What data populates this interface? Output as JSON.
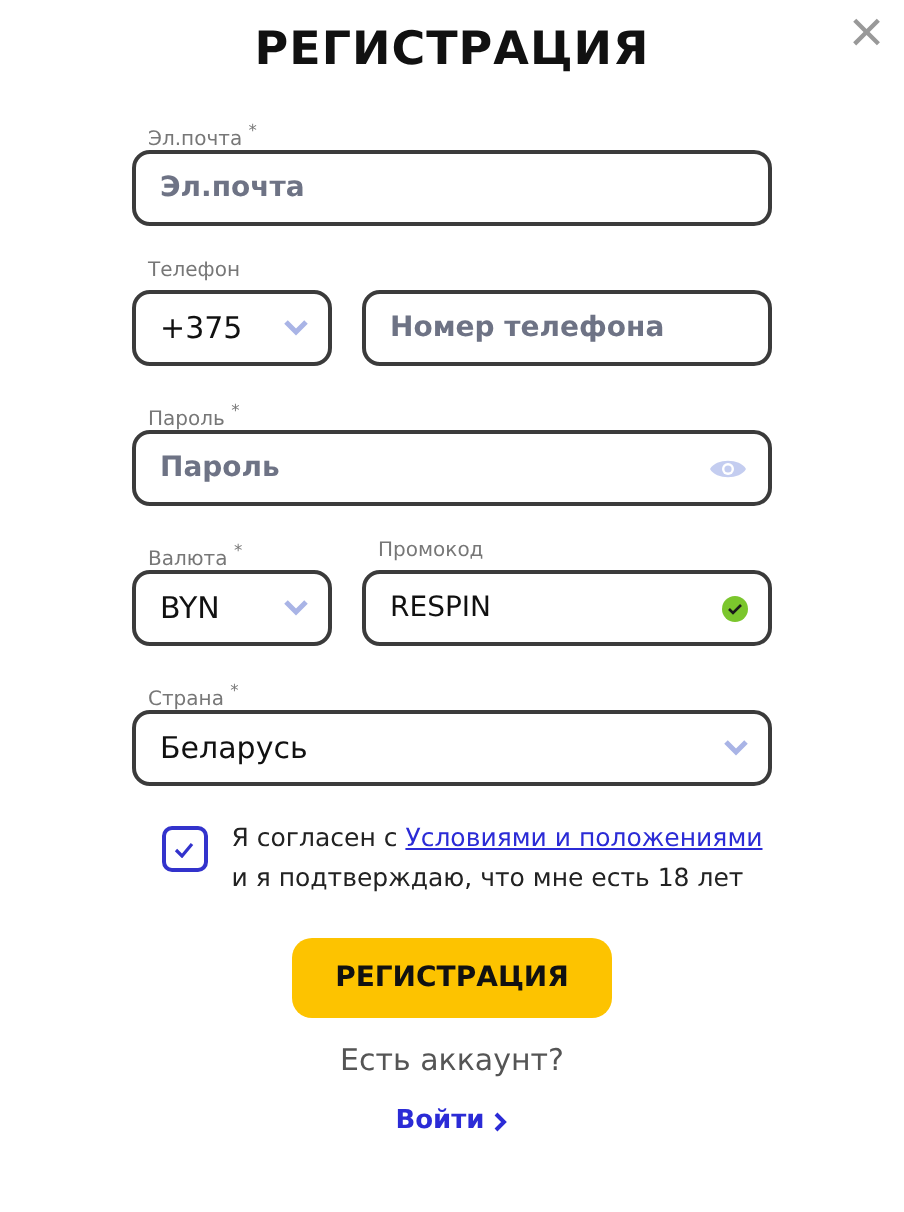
{
  "title": "РЕГИСТРАЦИЯ",
  "close": "×",
  "rows": [
    {
      "fields": [
        {
          "kind": "text",
          "label": "Эл.почта $^{*}$",
          "placeholder": "Эл.почта"
        }
      ]
    },
    {
      "fields": [
        {
          "kind": "select",
          "label": "Телефон",
          "value": "+375"
        },
        {
          "kind": "text",
          "placeholder": "Номер телефона"
        }
      ]
    },
    {
      "fields": [
        {
          "kind": "password",
          "label": "Пароль $^{*}$",
          "placeholder": "Пароль"
        }
      ]
    },
    {
      "fields": [
        {
          "kind": "select",
          "label": "Валюта $^{*}$",
          "value": "BYN"
        },
        {
          "kind": "promo",
          "label": "Промокод",
          "value": "RESPIN",
          "valid": true
        }
      ]
    },
    {
      "fields": [
        {
          "kind": "select",
          "label": "Страна $^{*}$",
          "value": "Беларусь"
        }
      ]
    }
  ],
  "agreement": {
    "checked": true,
    "before": "Я согласен с ",
    "link": "Условиями и положениями",
    "after": "и я подтверждаю, что мне есть 18 лет"
  },
  "submit": "РЕГИСТРАЦИЯ",
  "have_account": "Есть аккаунт?",
  "login": "Войти"
}
